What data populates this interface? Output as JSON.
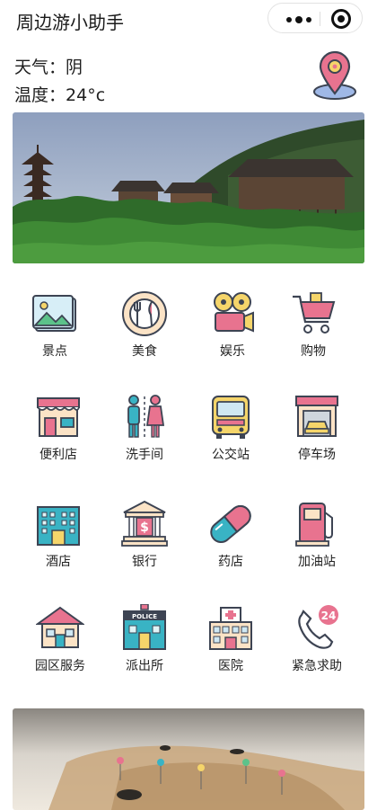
{
  "app": {
    "title": "周边游小助手"
  },
  "weather": {
    "condition_label": "天气：",
    "condition": "阴",
    "temperature_label": "温度：",
    "temperature": "24°c"
  },
  "grid": [
    {
      "label": "景点",
      "icon": "scenery-photo-icon"
    },
    {
      "label": "美食",
      "icon": "plate-cutlery-icon"
    },
    {
      "label": "娱乐",
      "icon": "film-projector-icon"
    },
    {
      "label": "购物",
      "icon": "shopping-cart-icon"
    },
    {
      "label": "便利店",
      "icon": "store-icon"
    },
    {
      "label": "洗手间",
      "icon": "restroom-icon"
    },
    {
      "label": "公交站",
      "icon": "bus-icon"
    },
    {
      "label": "停车场",
      "icon": "parking-garage-icon"
    },
    {
      "label": "酒店",
      "icon": "hotel-icon"
    },
    {
      "label": "银行",
      "icon": "bank-icon"
    },
    {
      "label": "药店",
      "icon": "pill-icon"
    },
    {
      "label": "加油站",
      "icon": "gas-pump-icon"
    },
    {
      "label": "园区服务",
      "icon": "house-icon"
    },
    {
      "label": "派出所",
      "icon": "police-station-icon"
    },
    {
      "label": "医院",
      "icon": "hospital-icon"
    },
    {
      "label": "紧急求助",
      "icon": "phone-24-icon"
    }
  ],
  "icons": {
    "police_sign": "POLICE",
    "emergency_badge": "24"
  },
  "colors": {
    "outline": "#3d4453",
    "pink": "#e8738f",
    "teal": "#39b3c4",
    "yellow": "#f5d56a",
    "cream": "#fbe3c6"
  }
}
